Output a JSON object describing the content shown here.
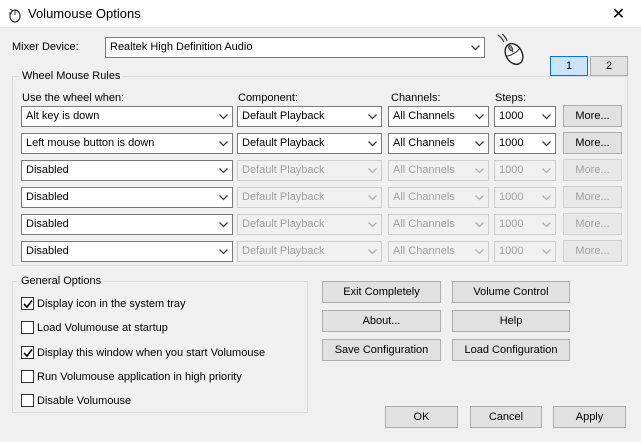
{
  "window": {
    "title": "Volumouse Options",
    "close_glyph": "✕"
  },
  "mixer": {
    "label": "Mixer Device:",
    "value": "Realtek High Definition Audio"
  },
  "pages": {
    "page1": "1",
    "page2": "2"
  },
  "rules": {
    "group_title": "Wheel Mouse Rules",
    "col_use": "Use the wheel when:",
    "col_component": "Component:",
    "col_channels": "Channels:",
    "col_steps": "Steps:",
    "rows": [
      {
        "condition": "Alt key is down",
        "component": "Default Playback",
        "channels": "All Channels",
        "steps": "1000",
        "more": "More...",
        "enabled": true
      },
      {
        "condition": "Left mouse button is down",
        "component": "Default Playback",
        "channels": "All Channels",
        "steps": "1000",
        "more": "More...",
        "enabled": true
      },
      {
        "condition": "Disabled",
        "component": "Default Playback",
        "channels": "All Channels",
        "steps": "1000",
        "more": "More...",
        "enabled": false
      },
      {
        "condition": "Disabled",
        "component": "Default Playback",
        "channels": "All Channels",
        "steps": "1000",
        "more": "More...",
        "enabled": false
      },
      {
        "condition": "Disabled",
        "component": "Default Playback",
        "channels": "All Channels",
        "steps": "1000",
        "more": "More...",
        "enabled": false
      },
      {
        "condition": "Disabled",
        "component": "Default Playback",
        "channels": "All Channels",
        "steps": "1000",
        "more": "More...",
        "enabled": false
      }
    ]
  },
  "general": {
    "group_title": "General Options",
    "options": [
      {
        "label": "Display icon in the system tray",
        "checked": true
      },
      {
        "label": "Load Volumouse at startup",
        "checked": false
      },
      {
        "label": "Display this window when you start Volumouse",
        "checked": true
      },
      {
        "label": "Run Volumouse application in high priority",
        "checked": false
      },
      {
        "label": "Disable Volumouse",
        "checked": false
      }
    ]
  },
  "actions": {
    "exit": "Exit Completely",
    "volume_control": "Volume Control",
    "about": "About...",
    "help": "Help",
    "save_config": "Save Configuration",
    "load_config": "Load Configuration"
  },
  "dialog": {
    "ok": "OK",
    "cancel": "Cancel",
    "apply": "Apply"
  }
}
